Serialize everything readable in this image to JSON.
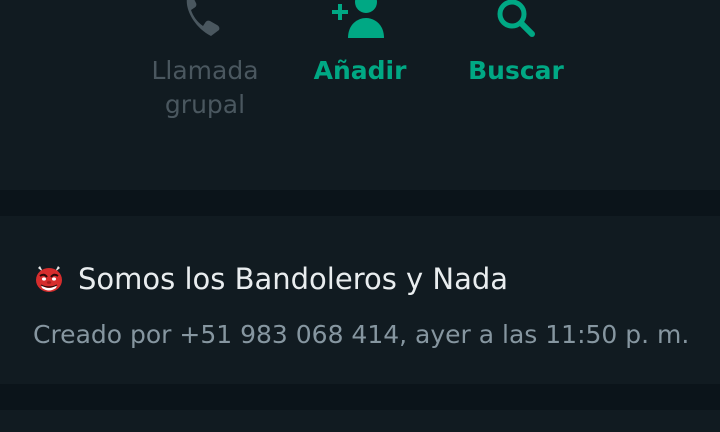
{
  "actions": {
    "group_call": {
      "label_line1": "Llamada",
      "label_line2": "grupal",
      "icon": "phone-plus-icon"
    },
    "add": {
      "label": "Añadir",
      "icon": "add-person-icon"
    },
    "search": {
      "label": "Buscar",
      "icon": "search-icon"
    }
  },
  "group": {
    "emoji": "devil-mask-emoji",
    "name": "Somos los Bandoleros y Nada",
    "created_by": "Creado por +51 983 068 414, ayer a las 11:50 p. m."
  },
  "colors": {
    "accent": "#00a884",
    "disabled": "#4a575f",
    "background": "#0b141a",
    "card": "#111b21",
    "primary_text": "#e9edef",
    "secondary_text": "#8696a0"
  }
}
